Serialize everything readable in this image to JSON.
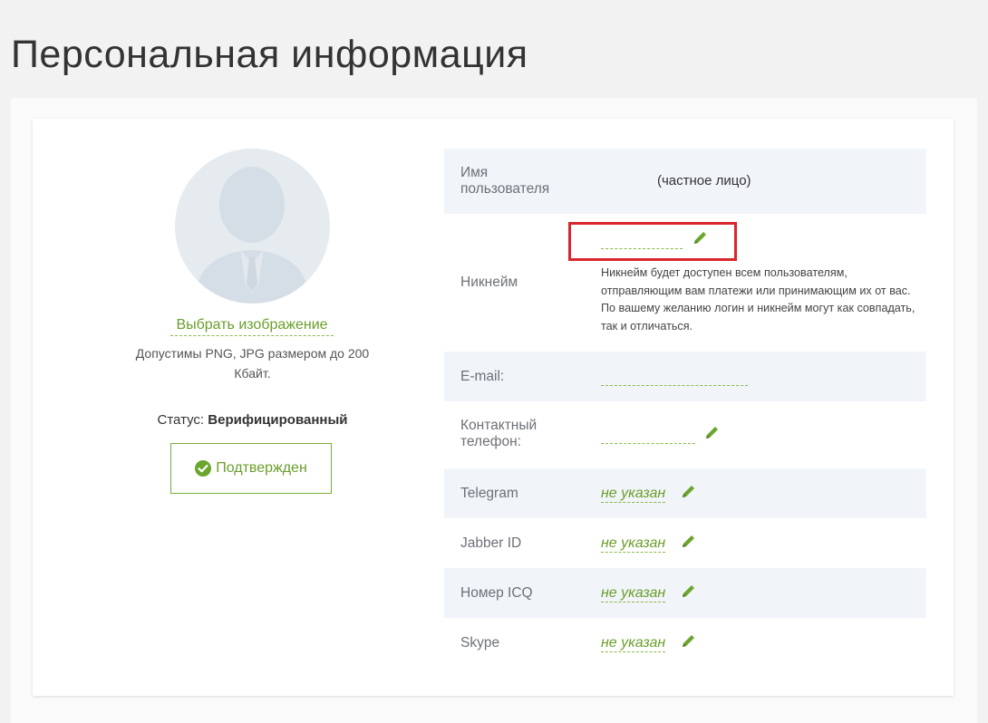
{
  "page": {
    "title": "Персональная информация"
  },
  "profile": {
    "choose_image_label": "Выбрать изображение",
    "allowed_formats_note": "Допустимы PNG, JPG размером до 200 Кбайт.",
    "status_label": "Статус:",
    "status_value": "Верифицированный",
    "confirmed_label": "Подтвержден"
  },
  "fields": {
    "username": {
      "label": "Имя пользователя",
      "value": "(частное лицо)"
    },
    "nickname": {
      "label": "Никнейм",
      "help": "Никнейм будет доступен всем пользователям, отправляющим вам платежи или принимающим их от вас. По вашему желанию логин и никнейм могут как совпадать, так и отличаться."
    },
    "email": {
      "label": "E-mail:"
    },
    "phone": {
      "label": "Контактный телефон:"
    },
    "telegram": {
      "label": "Telegram",
      "value": "не указан"
    },
    "jabber": {
      "label": "Jabber ID",
      "value": "не указан"
    },
    "icq": {
      "label": "Номер ICQ",
      "value": "не указан"
    },
    "skype": {
      "label": "Skype",
      "value": "не указан"
    }
  },
  "colors": {
    "accent_green": "#6a9e2a",
    "row_shade": "#f1f4f8",
    "highlight_red": "#d9272e"
  },
  "icons": [
    "avatar-placeholder-icon",
    "check-circle-icon",
    "pencil-icon"
  ]
}
